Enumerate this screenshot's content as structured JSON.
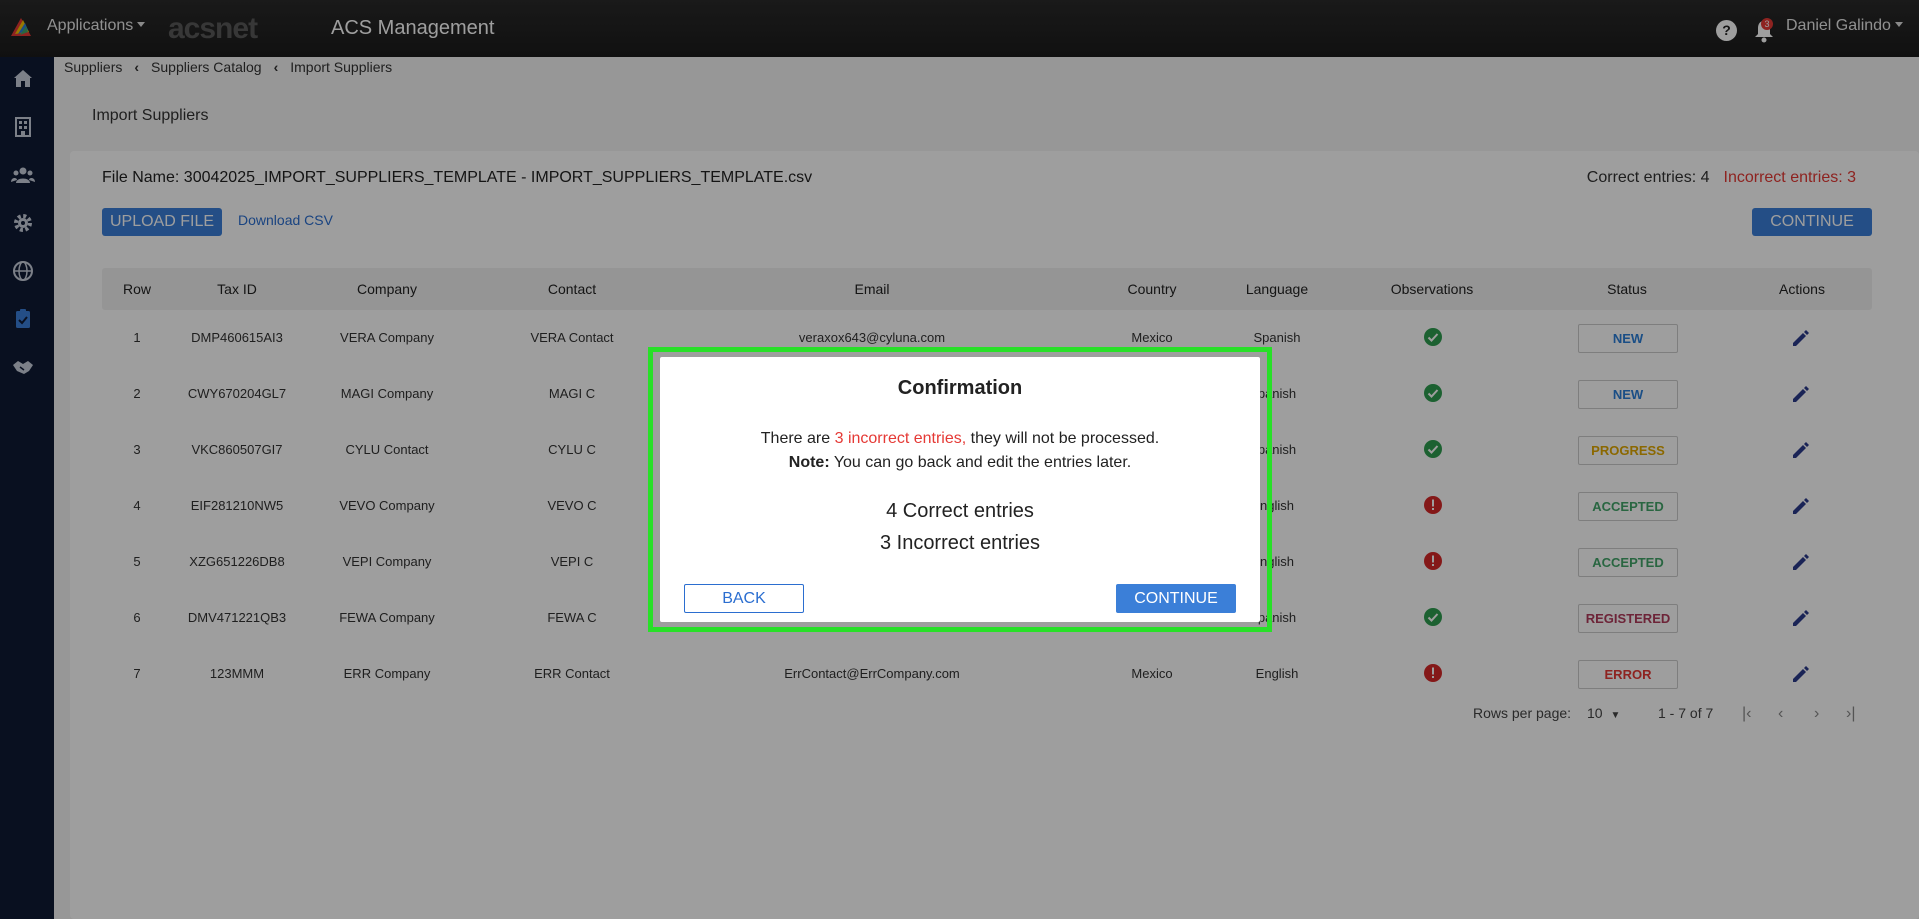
{
  "header": {
    "apps_label": "Applications",
    "brand_logo": "acsnet",
    "app_title": "ACS Management",
    "help_label": "?",
    "notification_count": "3",
    "user_name": "Daniel Galindo"
  },
  "sidebar": {
    "items": [
      "home-icon",
      "building-icon",
      "users-icon",
      "gear-icon",
      "globe-icon",
      "clipboard-check-icon",
      "handshake-icon"
    ]
  },
  "breadcrumb": {
    "items": [
      "Suppliers",
      "Suppliers Catalog",
      "Import Suppliers"
    ]
  },
  "page": {
    "title": "Import Suppliers",
    "file_name": "File Name: 30042025_IMPORT_SUPPLIERS_TEMPLATE - IMPORT_SUPPLIERS_TEMPLATE.csv",
    "correct_entries": "Correct entries: 4",
    "incorrect_entries": "Incorrect entries: 3",
    "upload_label": "UPLOAD FILE",
    "download_label": "Download CSV",
    "continue_label": "CONTINUE"
  },
  "table": {
    "headers": [
      "Row",
      "Tax ID",
      "Company",
      "Contact",
      "Email",
      "Country",
      "Language",
      "Observations",
      "Status",
      "Actions"
    ],
    "rows": [
      {
        "row": "1",
        "tax_id": "DMP460615AI3",
        "company": "VERA Company",
        "contact": "VERA Contact",
        "email": "veraxox643@cyluna.com",
        "country": "Mexico",
        "language": "Spanish",
        "obs": "ok",
        "status": "NEW"
      },
      {
        "row": "2",
        "tax_id": "CWY670204GL7",
        "company": "MAGI Company",
        "contact": "MAGI C",
        "email": "",
        "country": "",
        "language": "panish",
        "obs": "ok",
        "status": "NEW"
      },
      {
        "row": "3",
        "tax_id": "VKC860507GI7",
        "company": "CYLU Contact",
        "contact": "CYLU C",
        "email": "",
        "country": "",
        "language": "panish",
        "obs": "ok",
        "status": "PROGRESS"
      },
      {
        "row": "4",
        "tax_id": "EIF281210NW5",
        "company": "VEVO Company",
        "contact": "VEVO C",
        "email": "",
        "country": "",
        "language": "nglish",
        "obs": "error",
        "status": "ACCEPTED"
      },
      {
        "row": "5",
        "tax_id": "XZG651226DB8",
        "company": "VEPI Company",
        "contact": "VEPI C",
        "email": "",
        "country": "",
        "language": "nglish",
        "obs": "error",
        "status": "ACCEPTED"
      },
      {
        "row": "6",
        "tax_id": "DMV471221QB3",
        "company": "FEWA Company",
        "contact": "FEWA C",
        "email": "",
        "country": "",
        "language": "panish",
        "obs": "ok",
        "status": "REGISTERED"
      },
      {
        "row": "7",
        "tax_id": "123MMM",
        "company": "ERR Company",
        "contact": "ERR Contact",
        "email": "ErrContact@ErrCompany.com",
        "country": "Mexico",
        "language": "English",
        "obs": "error",
        "status": "ERROR"
      }
    ]
  },
  "status_colors": {
    "NEW": "#2b7fd8",
    "PROGRESS": "#e0a800",
    "ACCEPTED": "#43a56a",
    "REGISTERED": "#b03a5b",
    "ERROR": "#e53935"
  },
  "pagination": {
    "rows_per_page_label": "Rows per page:",
    "rows_per_page_value": "10",
    "range": "1 - 7 of 7"
  },
  "modal": {
    "title": "Confirmation",
    "msg_prefix": "There are ",
    "msg_count": "3 incorrect entries,",
    "msg_suffix": " they will not be processed.",
    "note_label": "Note:",
    "note_text": " You can go back and edit the entries later.",
    "correct_line": "4 Correct entries",
    "incorrect_line": "3 Incorrect entries",
    "back_label": "BACK",
    "continue_label": "CONTINUE"
  }
}
